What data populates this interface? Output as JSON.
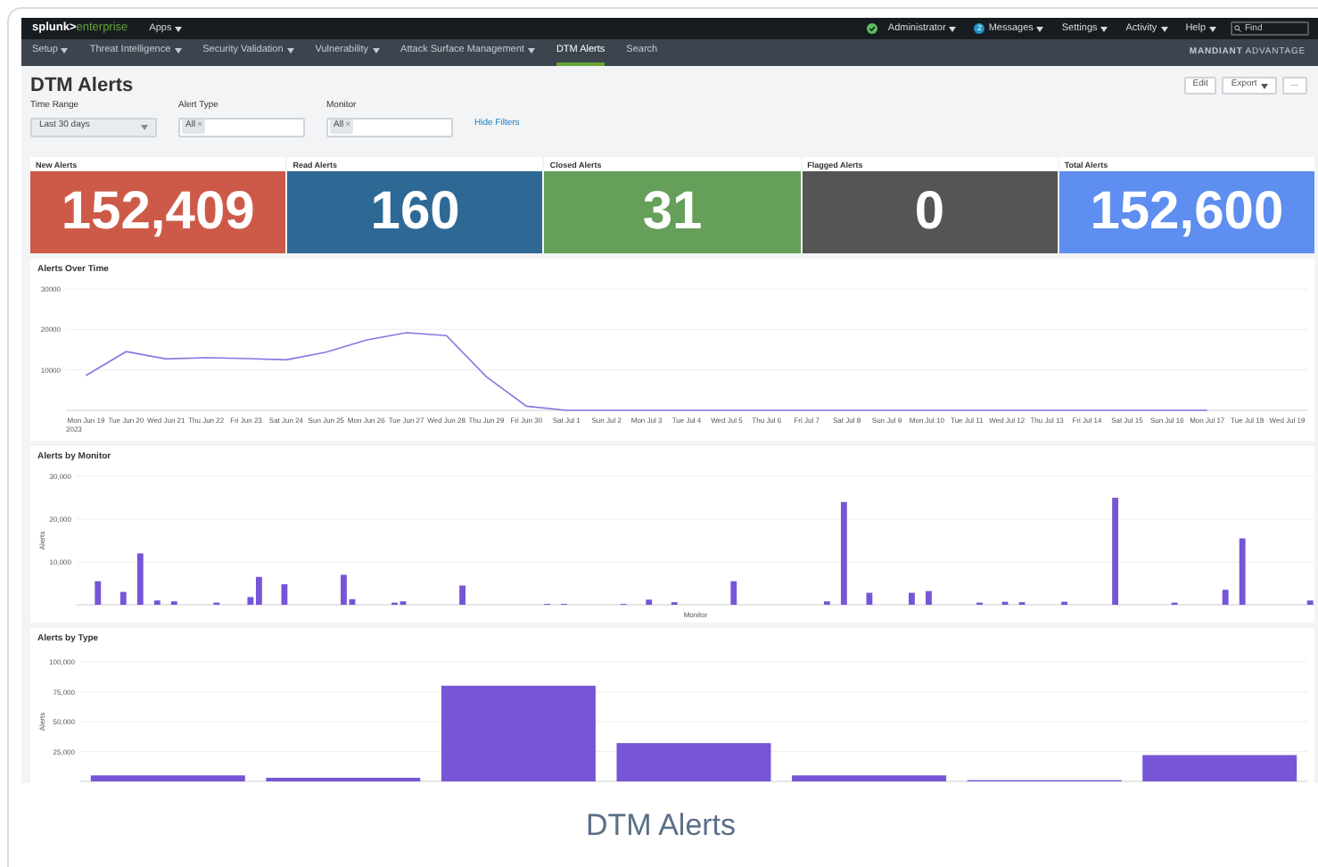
{
  "top_bar": {
    "logo": {
      "brand": "splunk>",
      "product": "enterprise"
    },
    "apps_menu": {
      "label": "Apps",
      "has_menu": true
    },
    "menus": [
      {
        "label": "Administrator",
        "has_menu": true
      },
      {
        "label": "Messages",
        "has_menu": true,
        "badge": "2"
      },
      {
        "label": "Settings",
        "has_menu": true
      },
      {
        "label": "Activity",
        "has_menu": true
      },
      {
        "label": "Help",
        "has_menu": true
      }
    ],
    "search": {
      "placeholder": "Find"
    }
  },
  "app_nav": {
    "items": [
      {
        "label": "Setup",
        "has_menu": true,
        "selected": false
      },
      {
        "label": "Threat Intelligence",
        "has_menu": true,
        "selected": false
      },
      {
        "label": "Security Validation",
        "has_menu": true,
        "selected": false
      },
      {
        "label": "Vulnerability",
        "has_menu": true,
        "selected": false
      },
      {
        "label": "Attack Surface Management",
        "has_menu": true,
        "selected": false
      },
      {
        "label": "DTM Alerts",
        "has_menu": false,
        "selected": true
      },
      {
        "label": "Search",
        "has_menu": false,
        "selected": false
      }
    ],
    "brand": "**MANDIANT** ADVANTAGE"
  },
  "dashboard": {
    "title": "DTM Alerts",
    "buttons": [
      {
        "label": "Edit",
        "has_menu": false
      },
      {
        "label": "Export",
        "has_menu": true
      },
      {
        "label": "...",
        "has_menu": false
      }
    ],
    "filters": [
      {
        "label": "Time Range",
        "kind": "dropdown",
        "value": "Last 30 days"
      },
      {
        "label": "Alert Type",
        "kind": "multiselect",
        "tokens": [
          {
            "label": "All",
            "remove": "×"
          }
        ]
      },
      {
        "label": "Monitor",
        "kind": "multiselect",
        "tokens": [
          {
            "label": "All",
            "remove": "×"
          }
        ]
      }
    ],
    "hide_filters_link": "Hide Filters"
  },
  "single_values": [
    {
      "title": "New Alerts",
      "value": "152,409",
      "color": "#cd5a48"
    },
    {
      "title": "Read Alerts",
      "value": "160",
      "color": "#2e6996"
    },
    {
      "title": "Closed Alerts",
      "value": "31",
      "color": "#659f59"
    },
    {
      "title": "Flagged Alerts",
      "value": "0",
      "color": "#555555"
    },
    {
      "title": "Total Alerts",
      "value": "152,600",
      "color": "#5d8ef0"
    }
  ],
  "charts": [
    {
      "title": "Alerts Over Time",
      "year_label": "2023",
      "chart_data": {
        "type": "line",
        "categories": [
          "Mon Jun 19",
          "Tue Jun 20",
          "Wed Jun 21",
          "Thu Jun 22",
          "Fri Jun 23",
          "Sat Jun 24",
          "Sun Jun 25",
          "Mon Jun 26",
          "Tue Jun 27",
          "Wed Jun 28",
          "Thu Jun 29",
          "Fri Jun 30",
          "Sat Jul 1",
          "Sun Jul 2",
          "Mon Jul 3",
          "Tue Jul 4",
          "Wed Jul 5",
          "Thu Jul 6",
          "Fri Jul 7",
          "Sat Jul 8",
          "Sun Jul 9",
          "Mon Jul 10",
          "Tue Jul 11",
          "Wed Jul 12",
          "Thu Jul 13",
          "Fri Jul 14",
          "Sat Jul 15",
          "Sun Jul 16",
          "Mon Jul 17",
          "Tue Jul 18",
          "Wed Jul 19"
        ],
        "grid": true,
        "series": [
          {
            "color": "#8c74e2",
            "values": [
              8600,
              14500,
              12700,
              13000,
              12800,
              12500,
              14400,
              17400,
              19200,
              18500,
              8300,
              1000,
              0,
              0,
              0,
              0,
              0,
              0,
              0,
              0,
              0,
              0,
              0,
              0,
              0,
              0,
              0,
              0,
              0,
              null,
              null
            ]
          }
        ],
        "ylim": [
          0,
          30000
        ],
        "yticks": [
          {
            "value": 10000,
            "label": "10000"
          },
          {
            "value": 20000,
            "label": "20000"
          },
          {
            "value": 30000,
            "label": "30000"
          }
        ]
      }
    },
    {
      "title": "Alerts by Monitor",
      "chart_data": {
        "type": "bar",
        "xlabel": "Monitor",
        "ylabel": "Alerts",
        "grid": true,
        "series": [
          {
            "color": "#7656d6",
            "values": [
              0,
              0,
              5500,
              0,
              0,
              3000,
              0,
              12000,
              0,
              1000,
              0,
              800,
              0,
              0,
              0,
              0,
              500,
              0,
              0,
              0,
              1800,
              6500,
              0,
              0,
              4800,
              0,
              0,
              0,
              0,
              0,
              0,
              7000,
              1300,
              0,
              0,
              0,
              0,
              500,
              800,
              0,
              0,
              0,
              0,
              0,
              0,
              4500,
              0,
              0,
              0,
              0,
              0,
              0,
              0,
              0,
              0,
              200,
              0,
              200,
              0,
              0,
              0,
              0,
              0,
              0,
              200,
              0,
              0,
              1200,
              0,
              0,
              600,
              0,
              0,
              0,
              0,
              0,
              0,
              5500,
              0,
              0,
              0,
              0,
              0,
              0,
              0,
              0,
              0,
              0,
              800,
              0,
              24000,
              0,
              0,
              2800,
              0,
              0,
              0,
              0,
              2800,
              0,
              3200,
              0,
              0,
              0,
              0,
              0,
              500,
              0,
              0,
              700,
              0,
              600,
              0,
              0,
              0,
              0,
              700,
              0,
              0,
              0,
              0,
              0,
              25000,
              0,
              0,
              0,
              0,
              0,
              0,
              500,
              0,
              0,
              0,
              0,
              0,
              3500,
              0,
              15500,
              0,
              0,
              0,
              0,
              0,
              0,
              0,
              1000
            ]
          }
        ],
        "ylim": [
          0,
          30000
        ],
        "yticks": [
          {
            "value": 10000,
            "label": "10,000"
          },
          {
            "value": 20000,
            "label": "20,000"
          },
          {
            "value": 30000,
            "label": "30,000"
          }
        ]
      }
    },
    {
      "title": "Alerts by Type",
      "chart_data": {
        "type": "bar",
        "ylabel": "Alerts",
        "grid": true,
        "series": [
          {
            "color": "#7656d6",
            "values": [
              5000,
              3000,
              80000,
              32000,
              5000,
              1000,
              22000
            ]
          }
        ],
        "ylim": [
          0,
          100000
        ],
        "yticks": [
          {
            "value": 25000,
            "label": "25,000"
          },
          {
            "value": 50000,
            "label": "50,000"
          },
          {
            "value": 75000,
            "label": "75,000"
          },
          {
            "value": 100000,
            "label": "100,000"
          }
        ]
      }
    }
  ],
  "caption": "DTM Alerts"
}
